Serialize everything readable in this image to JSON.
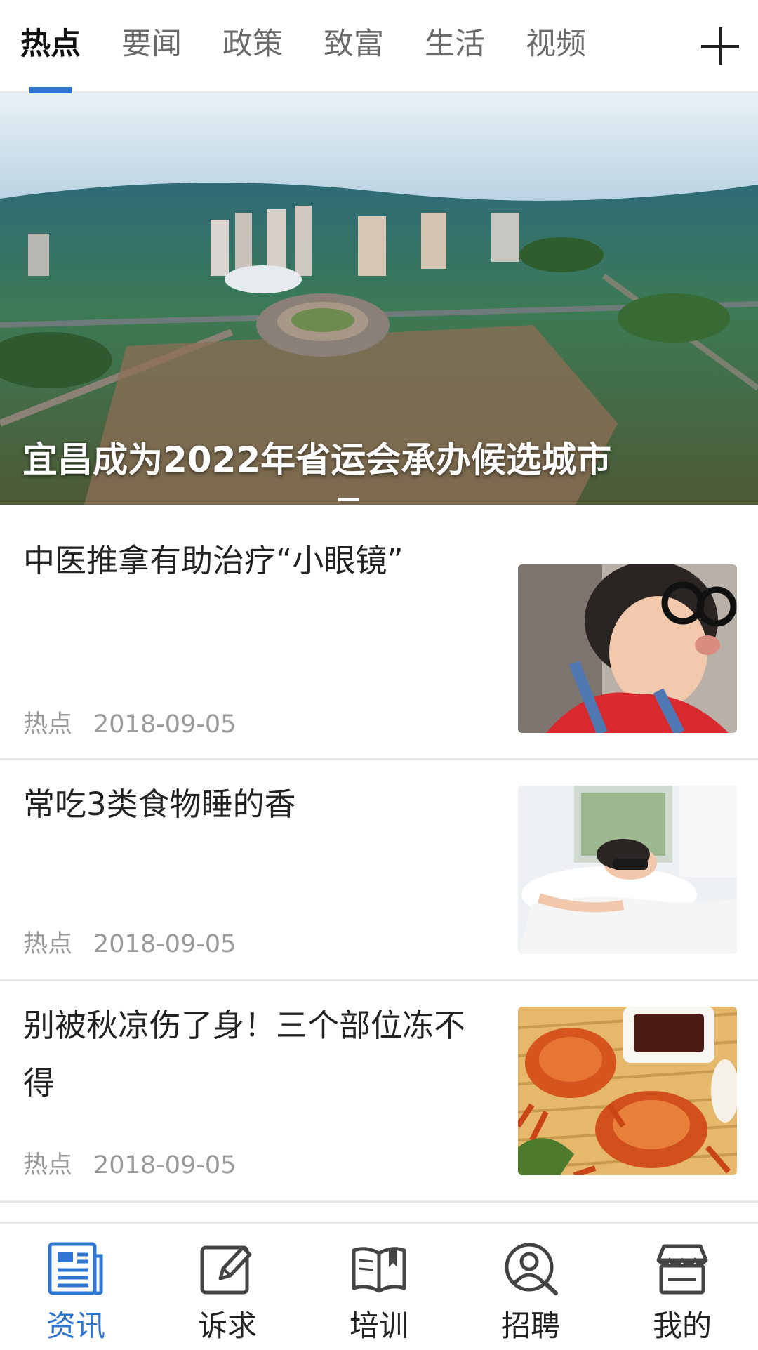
{
  "tabs": {
    "items": [
      {
        "label": "热点",
        "active": true
      },
      {
        "label": "要闻",
        "active": false
      },
      {
        "label": "政策",
        "active": false
      },
      {
        "label": "致富",
        "active": false
      },
      {
        "label": "生活",
        "active": false
      },
      {
        "label": "视频",
        "active": false
      }
    ],
    "add_icon": "plus-icon"
  },
  "banner": {
    "title": "宜昌成为2022年省运会承办候选城市",
    "page_indicator": {
      "current": 1,
      "total": 1
    }
  },
  "news": [
    {
      "title": "中医推拿有助治疗“小眼镜”",
      "category": "热点",
      "date": "2018-09-05",
      "thumb": "girl-with-glasses-photo"
    },
    {
      "title": "常吃3类食物睡的香",
      "category": "热点",
      "date": "2018-09-05",
      "thumb": "sleeping-woman-photo"
    },
    {
      "title": "别被秋凉伤了身！三个部位冻不得",
      "category": "热点",
      "date": "2018-09-05",
      "thumb": "crabs-photo"
    }
  ],
  "bottom_nav": [
    {
      "label": "资讯",
      "icon": "news-icon",
      "active": true
    },
    {
      "label": "诉求",
      "icon": "edit-icon",
      "active": false
    },
    {
      "label": "培训",
      "icon": "book-icon",
      "active": false
    },
    {
      "label": "招聘",
      "icon": "search-person-icon",
      "active": false
    },
    {
      "label": "我的",
      "icon": "store-icon",
      "active": false
    }
  ],
  "colors": {
    "accent": "#2e76d0",
    "text": "#222222",
    "muted": "#9a9a9a",
    "divider": "#e8e8e8"
  }
}
